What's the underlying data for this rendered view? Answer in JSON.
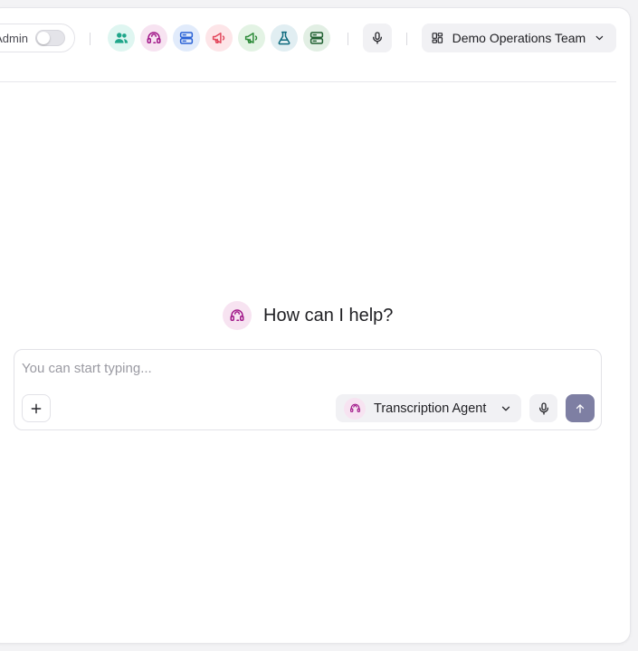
{
  "header": {
    "admin_toggle": {
      "label": "Admin",
      "enabled": false
    },
    "agents": [
      {
        "icon": "users-icon",
        "bg": "#dff6f1",
        "fg": "#1fa68a"
      },
      {
        "icon": "headset-icon",
        "bg": "#f7e3f1",
        "fg": "#a21a8a"
      },
      {
        "icon": "server-icon",
        "bg": "#e1ebfb",
        "fg": "#2a62d6"
      },
      {
        "icon": "megaphone-icon",
        "bg": "#fde5e8",
        "fg": "#e3485c"
      },
      {
        "icon": "megaphone-icon",
        "bg": "#e3f3e4",
        "fg": "#2e8b3a"
      },
      {
        "icon": "flask-icon",
        "bg": "#e1eef2",
        "fg": "#0f6b7e"
      },
      {
        "icon": "server-icon",
        "bg": "#e2efe4",
        "fg": "#1f5f30"
      }
    ],
    "team_select": {
      "label": "Demo Operations Team"
    }
  },
  "main": {
    "greeting": "How can I help?"
  },
  "composer": {
    "placeholder": "You can start typing...",
    "value": "",
    "agent_label": "Transcription Agent",
    "send_color": "#7e7fa3"
  }
}
